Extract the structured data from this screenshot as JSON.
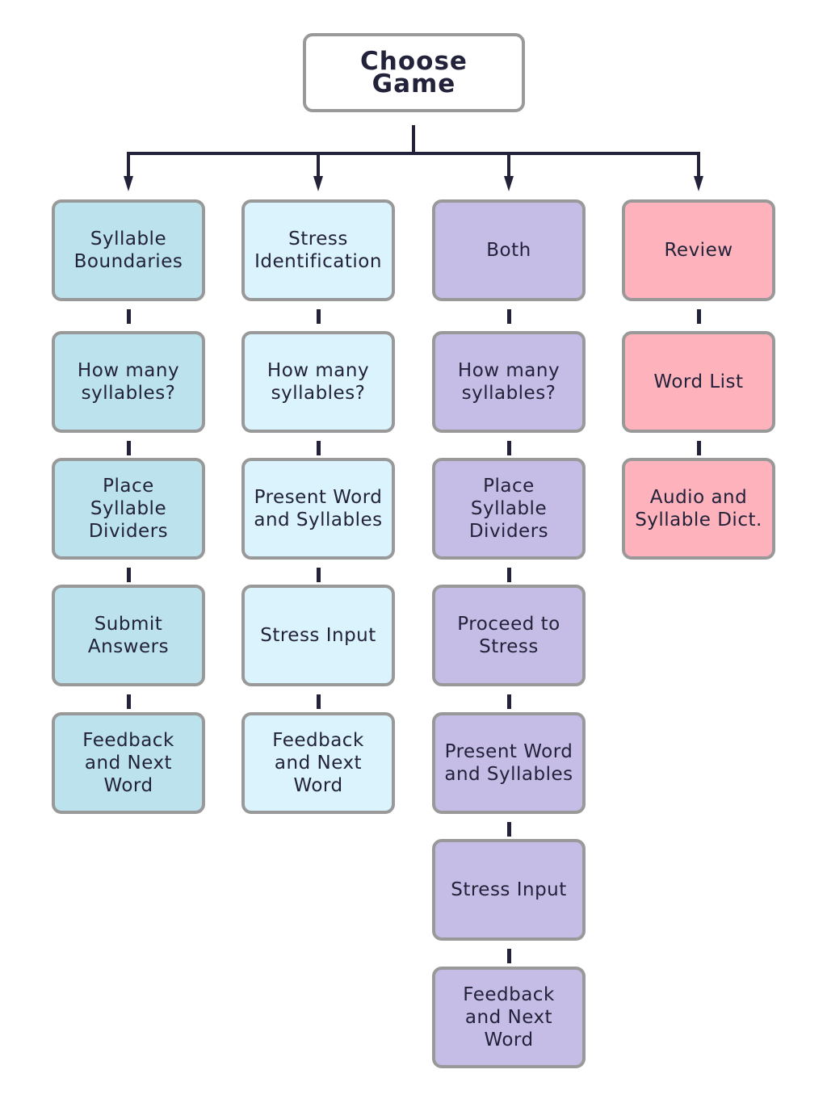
{
  "root": {
    "label": "Choose Game"
  },
  "colors": {
    "syllable": "#bce2ee",
    "stress": "#dbf3fd",
    "both": "#c5bde6",
    "review": "#feb3bc",
    "border": "#999999",
    "line": "#22223a"
  },
  "columns": [
    {
      "name": "syllable-boundaries",
      "color_key": "syllable",
      "steps": [
        "Syllable Boundaries",
        "How many syllables?",
        "Place Syllable Dividers",
        "Submit Answers",
        "Feedback and Next Word"
      ]
    },
    {
      "name": "stress-identification",
      "color_key": "stress",
      "steps": [
        "Stress Identification",
        "How many syllables?",
        "Present Word and Syllables",
        "Stress Input",
        "Feedback and Next Word"
      ]
    },
    {
      "name": "both",
      "color_key": "both",
      "steps": [
        "Both",
        "How many syllables?",
        "Place Syllable Dividers",
        "Proceed to Stress",
        "Present Word and Syllables",
        "Stress Input",
        "Feedback and Next Word"
      ]
    },
    {
      "name": "review",
      "color_key": "review",
      "steps": [
        "Review",
        "Word List",
        "Audio and Syllable Dict."
      ]
    }
  ]
}
